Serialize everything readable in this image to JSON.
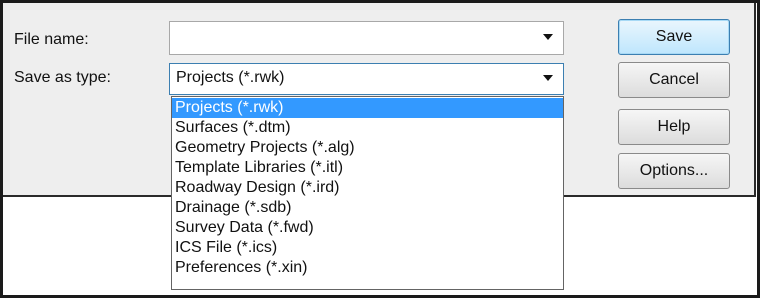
{
  "form": {
    "file_name_label": "File name:",
    "file_name_value": "",
    "save_as_type_label": "Save as type:",
    "save_as_type_value": "Projects (*.rwk)"
  },
  "buttons": {
    "save": "Save",
    "cancel": "Cancel",
    "help": "Help",
    "options": "Options..."
  },
  "type_options": [
    {
      "label": "Projects (*.rwk)",
      "selected": true
    },
    {
      "label": "Surfaces (*.dtm)",
      "selected": false
    },
    {
      "label": "Geometry Projects (*.alg)",
      "selected": false
    },
    {
      "label": "Template Libraries (*.itl)",
      "selected": false
    },
    {
      "label": "Roadway Design (*.ird)",
      "selected": false
    },
    {
      "label": "Drainage (*.sdb)",
      "selected": false
    },
    {
      "label": "Survey Data (*.fwd)",
      "selected": false
    },
    {
      "label": "ICS File (*.ics)",
      "selected": false
    },
    {
      "label": "Preferences (*.xin)",
      "selected": false
    }
  ],
  "colors": {
    "selection": "#3399ff",
    "default_button_border": "#3c7fb1",
    "dialog_background": "#eeeeee"
  }
}
